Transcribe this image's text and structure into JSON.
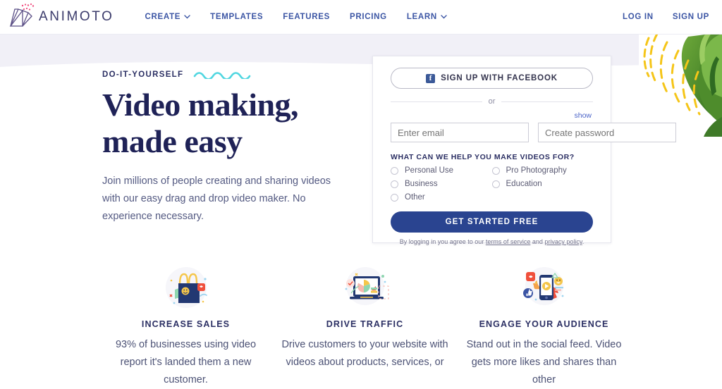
{
  "brand": {
    "name": "ANIMOTO",
    "logo_icon": "animoto-fan-logo",
    "accent_navy": "#2a4490",
    "accent_blue": "#3b55a4",
    "accent_cyan": "#4fd6e0",
    "accent_mint": "#c9e5dd",
    "accent_lavender": "#f1f0f7"
  },
  "header": {
    "nav": [
      {
        "label": "CREATE",
        "has_chevron": true,
        "icon": "chevron-down-icon"
      },
      {
        "label": "TEMPLATES",
        "has_chevron": false
      },
      {
        "label": "FEATURES",
        "has_chevron": false
      },
      {
        "label": "PRICING",
        "has_chevron": false
      },
      {
        "label": "LEARN",
        "has_chevron": true,
        "icon": "chevron-down-icon"
      }
    ],
    "login_label": "LOG IN",
    "signup_label": "SIGN UP"
  },
  "hero": {
    "eyebrow": "DO-IT-YOURSELF",
    "squiggle_icon": "wavy-squiggle-icon",
    "headline_line1": "Video making,",
    "headline_line2": "made easy",
    "subcopy": "Join millions of people creating and sharing videos with our easy drag and drop video maker. No experience necessary."
  },
  "signup": {
    "facebook_icon": "facebook-icon",
    "facebook_label": "SIGN UP WITH FACEBOOK",
    "divider_label": "or",
    "show_password_label": "show",
    "email_placeholder": "Enter email",
    "email_value": "",
    "password_placeholder": "Create password",
    "password_value": "",
    "question_label": "WHAT CAN WE HELP YOU MAKE VIDEOS FOR?",
    "options": [
      {
        "label": "Personal Use",
        "selected": false
      },
      {
        "label": "Pro Photography",
        "selected": false
      },
      {
        "label": "Business",
        "selected": false
      },
      {
        "label": "Education",
        "selected": false
      },
      {
        "label": "Other",
        "selected": false
      }
    ],
    "cta_label": "GET STARTED FREE",
    "terms_prefix": "By logging in you agree to our ",
    "terms_link": "terms of service",
    "terms_middle": " and ",
    "privacy_link": "privacy policy",
    "terms_suffix": "."
  },
  "features": [
    {
      "icon": "shopping-bag-smiley-icon",
      "title": "INCREASE SALES",
      "body": "93% of businesses using video report it's landed them a new customer."
    },
    {
      "icon": "laptop-pie-chart-icon",
      "title": "DRIVE TRAFFIC",
      "body": "Drive customers to your website with videos about products, services, or"
    },
    {
      "icon": "hand-phone-play-icon",
      "title": "ENGAGE YOUR AUDIENCE",
      "body": "Stand out in the social feed. Video gets more likes and shares than other"
    }
  ]
}
